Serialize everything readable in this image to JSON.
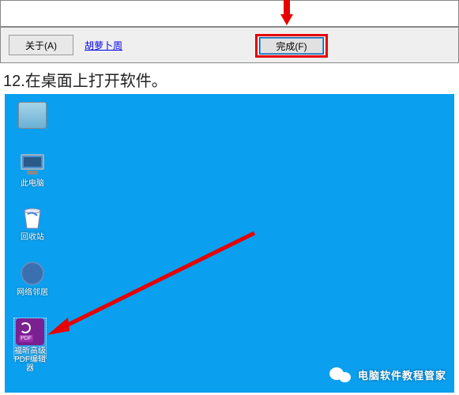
{
  "dialog": {
    "about_label": "关于(A)",
    "link_label": "胡萝卜周",
    "finish_label": "完成(F)"
  },
  "instruction": "12.在桌面上打开软件。",
  "desktop": {
    "icons": {
      "user": "",
      "pc": "此电脑",
      "trash": "回收站",
      "net": "网络邻居",
      "pdf": "福昕高级PDF编辑器"
    }
  },
  "watermark": "电脑软件教程管家"
}
